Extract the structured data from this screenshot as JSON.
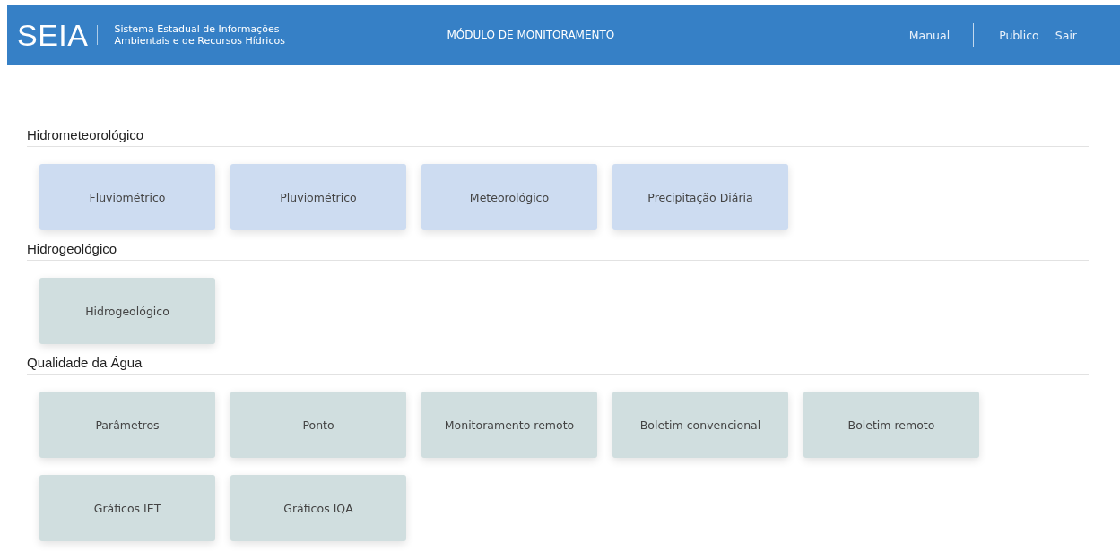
{
  "header": {
    "logo": "SEIA",
    "system_name": [
      "Sistema Estadual de Informações",
      "Ambientais e de Recursos Hídricos"
    ],
    "module": "MÓDULO DE MONITORAMENTO",
    "links": [
      "Manual",
      "Publico",
      "Sair"
    ]
  },
  "sections": [
    {
      "title": "Hidrometeorológico",
      "color": "#cddcf1",
      "cards": [
        "Fluviométrico",
        "Pluviométrico",
        "Meteorológico",
        "Precipitação Diária"
      ]
    },
    {
      "title": "Hidrogeológico",
      "color": "#d0dedf",
      "cards": [
        "Hidrogeológico"
      ]
    },
    {
      "title": "Qualidade da Água",
      "color": "#d0dedf",
      "cards": [
        "Parâmetros",
        "Ponto",
        "Monitoramento remoto",
        "Boletim convencional",
        "Boletim remoto",
        "Gráficos IET",
        "Gráficos IQA"
      ]
    }
  ]
}
